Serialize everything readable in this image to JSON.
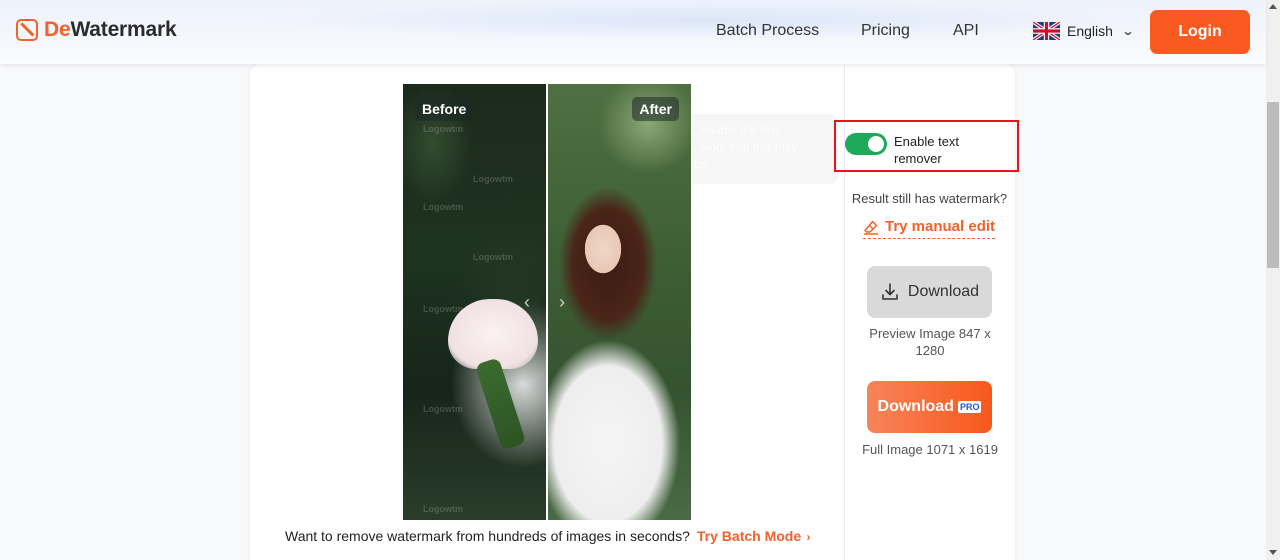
{
  "header": {
    "logo_prefix": "De",
    "logo_suffix": "Watermark",
    "nav": [
      "Batch Process",
      "Pricing",
      "API"
    ],
    "language": "English",
    "login_label": "Login"
  },
  "compare": {
    "before_label": "Before",
    "after_label": "After",
    "watermark_text": "Logowtm"
  },
  "tooltip": {
    "lines": [
      ", enable the text",
      ". Note that this may",
      "ge."
    ]
  },
  "panel": {
    "toggle_label": "Enable text remover",
    "toggle_on": true,
    "still_has": "Result still has watermark?",
    "manual_edit": "Try manual edit",
    "download_free_label": "Download",
    "download_free_meta": "Preview Image 847 x 1280",
    "download_pro_label": "Download",
    "pro_badge": "PRO",
    "download_pro_meta": "Full Image 1071 x 1619"
  },
  "promo": {
    "text": "Want to remove watermark from hundreds of images in seconds?",
    "link": "Try Batch Mode"
  },
  "colors": {
    "brand": "#f4612a",
    "login_bg": "#f85a22",
    "toggle_on": "#1daa5a",
    "highlight_border": "#e8141c",
    "pro_badge_text": "#2b4fd6"
  }
}
